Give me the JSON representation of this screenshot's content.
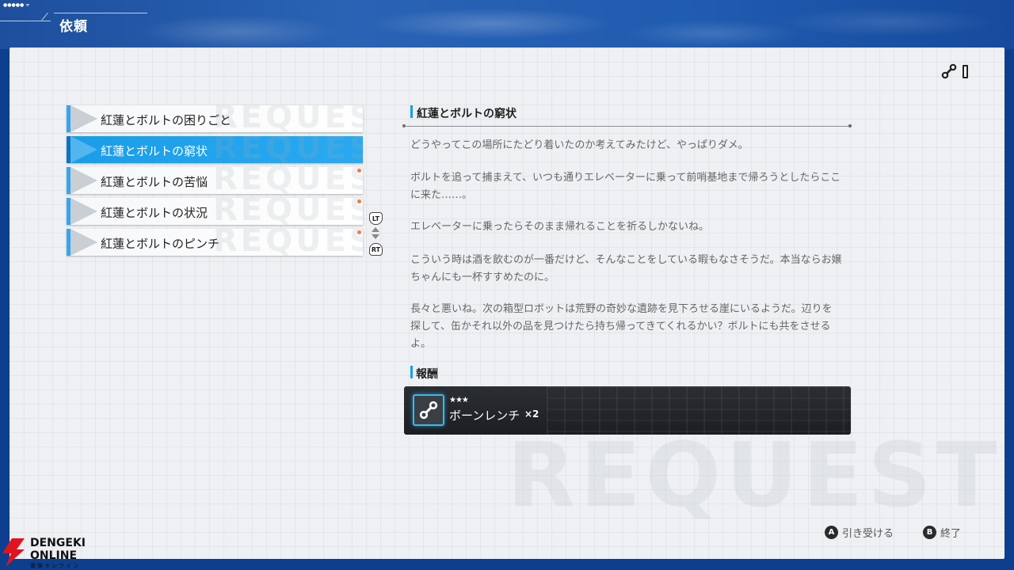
{
  "header": {
    "title": "依頼"
  },
  "request_list": {
    "items": [
      {
        "label": "紅蓮とボルトの困りごと",
        "active": false,
        "new": false
      },
      {
        "label": "紅蓮とボルトの窮状",
        "active": true,
        "new": false
      },
      {
        "label": "紅蓮とボルトの苦悩",
        "active": false,
        "new": true
      },
      {
        "label": "紅蓮とボルトの状況",
        "active": false,
        "new": true
      },
      {
        "label": "紅蓮とボルトのピンチ",
        "active": false,
        "new": true
      }
    ],
    "lt_label": "LT",
    "rt_label": "RT"
  },
  "detail": {
    "title": "紅蓮とボルトの窮状",
    "paragraphs": [
      "どうやってこの場所にたどり着いたのか考えてみたけど、やっぱりダメ。",
      "ボルトを追って捕まえて、いつも通りエレベーターに乗って前哨基地まで帰ろうとしたらここに来た……。",
      "エレベーターに乗ったらそのまま帰れることを祈るしかないね。",
      "こういう時は酒を飲むのが一番だけど、そんなことをしている暇もなさそうだ。本当ならお嬢ちゃんにも一杯すすめたのに。",
      "長々と悪いね。次の箱型ロボットは荒野の奇妙な遺跡を見下ろせる崖にいるようだ。辺りを探して、缶かそれ以外の品を見つけたら持ち帰ってきてくれるかい？ボルトにも共をさせるよ。"
    ]
  },
  "reward": {
    "heading": "報酬",
    "stars": "★★★",
    "item_name": "ボーンレンチ",
    "quantity": "×2",
    "icon": "wrench-icon",
    "accent": "#39b8ee"
  },
  "footer": {
    "accept_key": "A",
    "accept_label": "引き受ける",
    "exit_key": "B",
    "exit_label": "終了"
  },
  "logo": {
    "line1": "DENGEKI",
    "line2": "ONLINE",
    "line3": "電撃オンライン"
  },
  "watermark": "REQUEST",
  "colors": {
    "active_item": "#1a9de8",
    "new_dot": "#f07a4a",
    "header": "#1d4f9d"
  }
}
